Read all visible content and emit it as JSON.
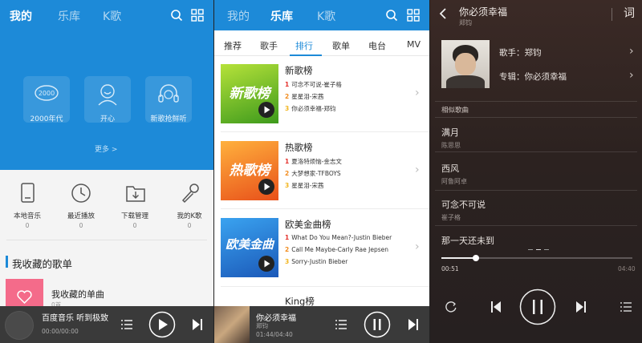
{
  "panel1": {
    "tabs": [
      "我的",
      "乐库",
      "K歌"
    ],
    "hero": [
      {
        "label": "2000年代"
      },
      {
        "label": "开心"
      },
      {
        "label": "新歌抢鲜听"
      }
    ],
    "more": "更多 >",
    "quick": [
      {
        "label": "本地音乐",
        "count": "0"
      },
      {
        "label": "最近播放",
        "count": "0"
      },
      {
        "label": "下载管理",
        "count": "0"
      },
      {
        "label": "我的K歌",
        "count": "0"
      }
    ],
    "section_title": "我收藏的歌单",
    "fav": {
      "title": "我收藏的单曲",
      "count": "0首"
    },
    "player": {
      "title": "百度音乐 听到极致",
      "time": "00:00/00:00"
    }
  },
  "panel2": {
    "tabs": [
      "我的",
      "乐库",
      "K歌"
    ],
    "subtabs": [
      "推荐",
      "歌手",
      "排行",
      "歌单",
      "电台",
      "MV"
    ],
    "ranks": [
      {
        "name": "新歌榜",
        "badge": "新歌榜",
        "color1": "#b6e23a",
        "color2": "#3d9a1c",
        "lines": [
          {
            "n": "1",
            "t": "可念不可说-崔子格"
          },
          {
            "n": "2",
            "t": "星星泪-宋茜"
          },
          {
            "n": "3",
            "t": "你必须幸福-郑钧"
          }
        ]
      },
      {
        "name": "热歌榜",
        "badge": "热歌榜",
        "color1": "#ffb13d",
        "color2": "#e8501a",
        "lines": [
          {
            "n": "1",
            "t": "夏洛特烦恼-金志文"
          },
          {
            "n": "2",
            "t": "大梦想家-TFBOYS"
          },
          {
            "n": "3",
            "t": "星星泪-宋茜"
          }
        ]
      },
      {
        "name": "欧美金曲榜",
        "badge": "欧美金曲",
        "color1": "#3aa3f0",
        "color2": "#1b58b8",
        "lines": [
          {
            "n": "1",
            "t": "What Do You Mean?-Justin Bieber"
          },
          {
            "n": "2",
            "t": "Call Me Maybe-Carly Rae Jepsen"
          },
          {
            "n": "3",
            "t": "Sorry-Justin Bieber"
          }
        ]
      }
    ],
    "king": "King榜",
    "player": {
      "title": "你必须幸福",
      "artist": "郑钧",
      "time": "01:44/04:40"
    }
  },
  "panel3": {
    "song": "你必须幸福",
    "artist_top": "郑钧",
    "lyric_btn": "词",
    "artist_row": "歌手：郑钧",
    "album_row": "专辑：你必须幸福",
    "similar_title": "相似歌曲",
    "similar": [
      {
        "title": "满月",
        "artist": "陈思思"
      },
      {
        "title": "西风",
        "artist": "阿鲁阿卓"
      },
      {
        "title": "可念不可说",
        "artist": "崔子格"
      },
      {
        "title": "那一天还未到",
        "artist": ""
      }
    ],
    "elapsed": "00:51",
    "total": "04:40",
    "progress": 0.18
  }
}
